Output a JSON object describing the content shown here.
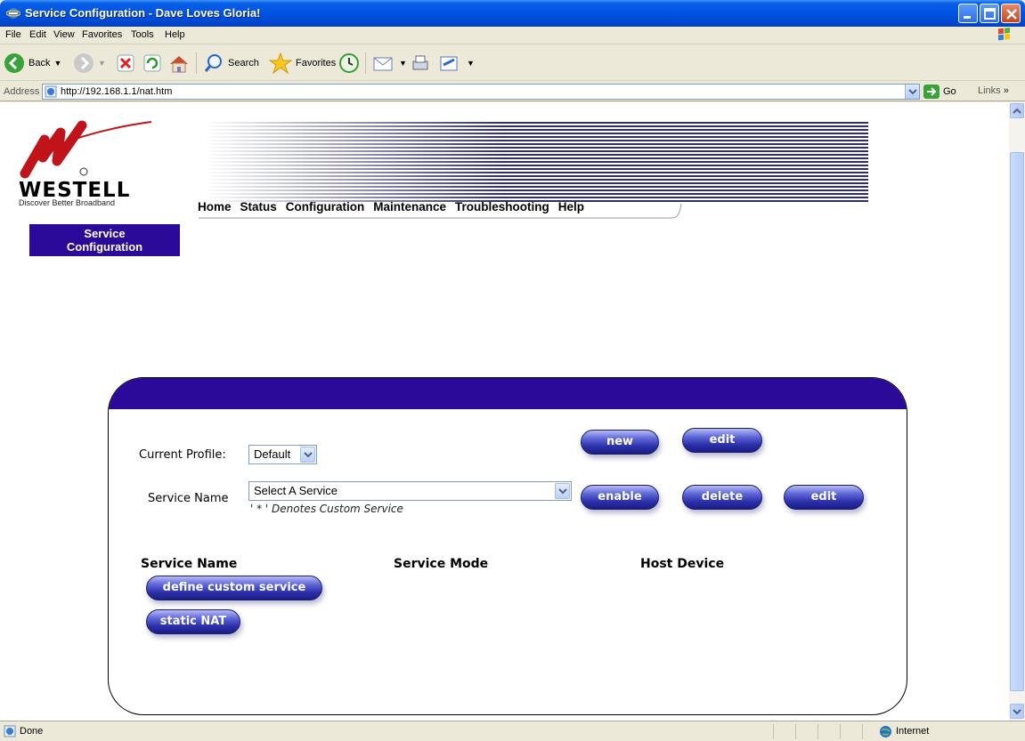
{
  "window": {
    "title": "Service Configuration - Dave Loves Gloria!"
  },
  "menu": [
    "File",
    "Edit",
    "View",
    "Favorites",
    "Tools",
    "Help"
  ],
  "toolbar": {
    "back_label": "Back",
    "search_label": "Search",
    "favorites_label": "Favorites"
  },
  "address": {
    "label": "Address",
    "url": "http://192.168.1.1/nat.htm",
    "go_label": "Go",
    "links_label": "Links"
  },
  "page": {
    "brand": "WESTELL",
    "tagline": "Discover Better Broadband",
    "nav": [
      "Home",
      "Status",
      "Configuration",
      "Maintenance",
      "Troubleshooting",
      "Help"
    ],
    "section_line1": "Service",
    "section_line2": "Configuration",
    "current_profile_label": "Current Profile:",
    "current_profile_value": "Default",
    "service_name_label": "Service Name",
    "service_select_value": "Select A Service",
    "custom_note": "' * ' Denotes Custom Service",
    "buttons": {
      "new": "new",
      "edit_profile": "edit",
      "enable": "enable",
      "delete": "delete",
      "edit_service": "edit",
      "define_custom": "define custom service",
      "static_nat": "static NAT"
    },
    "table_headers": {
      "service_name": "Service Name",
      "service_mode": "Service Mode",
      "host_device": "Host Device"
    }
  },
  "status": {
    "text": "Done",
    "zone": "Internet"
  },
  "colors": {
    "westell_purple": "#2b0a99",
    "xp_blue": "#0053e1"
  }
}
